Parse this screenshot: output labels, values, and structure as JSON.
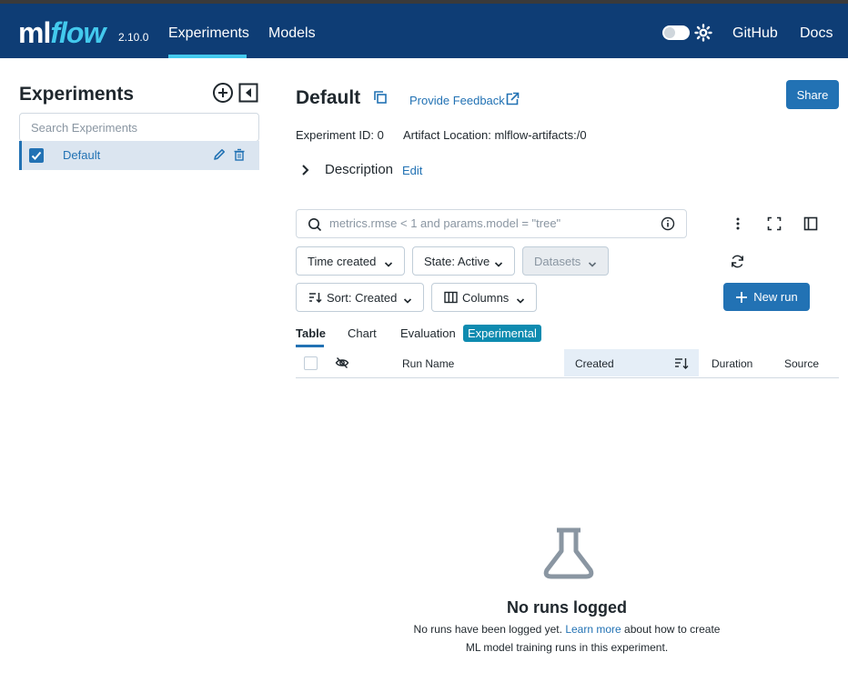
{
  "header": {
    "logo_ml": "ml",
    "logo_flow": "flow",
    "version": "2.10.0",
    "nav": [
      {
        "label": "Experiments"
      },
      {
        "label": "Models"
      },
      {
        "label": "GitHub"
      },
      {
        "label": "Docs"
      }
    ],
    "brand_color": "#0e3d75",
    "accent_color": "#43c9ed"
  },
  "sidebar": {
    "title": "Experiments",
    "search_placeholder": "Search Experiments",
    "experiments": [
      {
        "name": "Default",
        "checked": true
      }
    ]
  },
  "main": {
    "title": "Default",
    "feedback_label": "Provide Feedback",
    "share_label": "Share",
    "experiment_id": "Experiment ID: 0",
    "artifact_location": "Artifact Location: mlflow-artifacts:/0",
    "description_label": "Description",
    "description_edit": "Edit",
    "filter_placeholder": "metrics.rmse < 1 and params.model = \"tree\"",
    "filters": {
      "time": "Time created",
      "state": "State: Active",
      "datasets": "Datasets",
      "sort": "Sort: Created",
      "columns": "Columns"
    },
    "new_run_label": "New run",
    "tabs": [
      {
        "label": "Table",
        "active": true
      },
      {
        "label": "Chart"
      },
      {
        "label": "Evaluation"
      }
    ],
    "experimental_badge": "Experimental",
    "table_columns": [
      "Run Name",
      "Created",
      "Duration",
      "Source"
    ],
    "empty_title": "No runs logged",
    "empty_text_before": "No runs have been logged yet.",
    "empty_link": "Learn more",
    "empty_text_after": "about how to create ML model training runs in this experiment."
  }
}
